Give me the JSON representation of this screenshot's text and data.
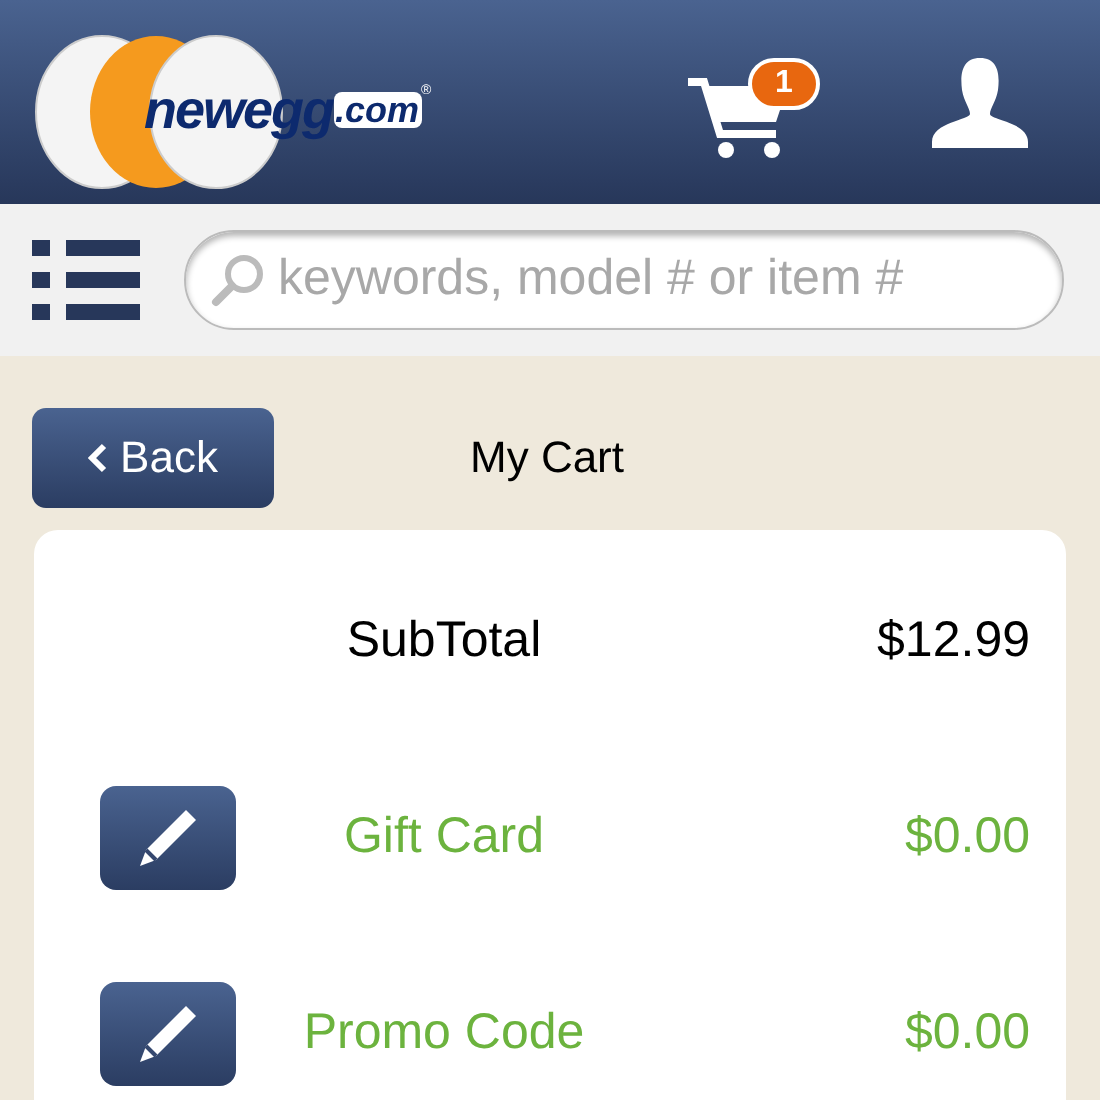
{
  "header": {
    "logo": {
      "name": "newegg",
      "suffix": ".com",
      "mark": "®"
    },
    "cart": {
      "count": "1"
    }
  },
  "search": {
    "placeholder": "keywords, model # or item #"
  },
  "nav": {
    "back": "Back",
    "title": "My Cart"
  },
  "summary": [
    {
      "kind": "total",
      "label": "SubTotal",
      "value": "$12.99"
    },
    {
      "kind": "editable",
      "label": "Gift Card",
      "value": "$0.00"
    },
    {
      "kind": "editable",
      "label": "Promo Code",
      "value": "$0.00"
    }
  ]
}
